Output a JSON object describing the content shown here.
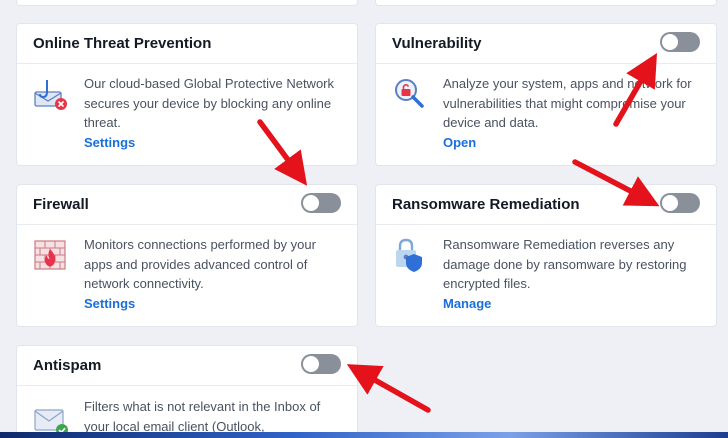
{
  "cards": {
    "online_threat": {
      "title": "Online Threat Prevention",
      "desc": "Our cloud-based Global Protective Network secures your device by blocking any online threat.",
      "link": "Settings"
    },
    "vulnerability": {
      "title": "Vulnerability",
      "desc": "Analyze your system, apps and network for vulnerabilities that might compromise your device and data.",
      "link": "Open",
      "toggle_on": false
    },
    "firewall": {
      "title": "Firewall",
      "desc": "Monitors connections performed by your apps and provides advanced control of network connectivity.",
      "link": "Settings",
      "toggle_on": false
    },
    "ransomware": {
      "title": "Ransomware Remediation",
      "desc": "Ransomware Remediation reverses any damage done by ransomware by restoring encrypted files.",
      "link": "Manage",
      "toggle_on": false
    },
    "antispam": {
      "title": "Antispam",
      "desc": "Filters what is not relevant in the Inbox of your local email client (Outlook,",
      "toggle_on": false
    }
  },
  "colors": {
    "link": "#1a6fd8",
    "toggle_off": "#8a9099",
    "annotation_arrow": "#e3121b",
    "icon_accent": "#e8334a",
    "icon_blue": "#2f6fd6"
  }
}
